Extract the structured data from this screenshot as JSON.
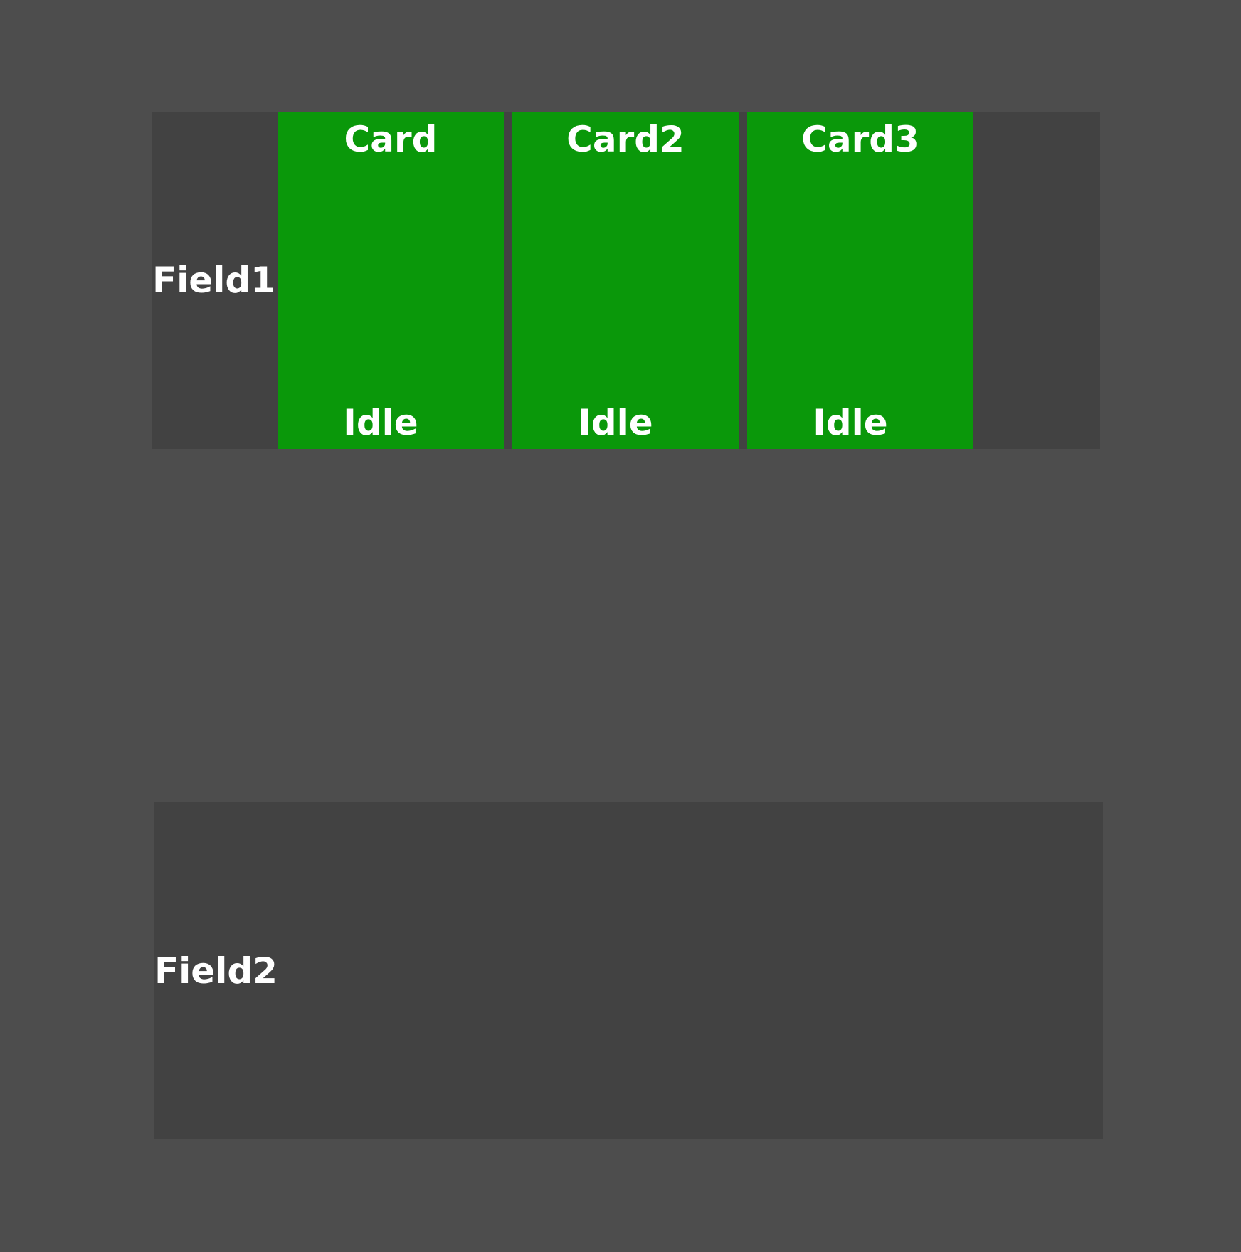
{
  "colors": {
    "background": "#4d4d4d",
    "field": "#424242",
    "card": "#0a980a",
    "text": "#ffffff"
  },
  "field1": {
    "label": "Field1",
    "cards": [
      {
        "title": "Card",
        "status": "Idle"
      },
      {
        "title": "Card2",
        "status": "Idle"
      },
      {
        "title": "Card3",
        "status": "Idle"
      }
    ]
  },
  "field2": {
    "label": "Field2"
  }
}
